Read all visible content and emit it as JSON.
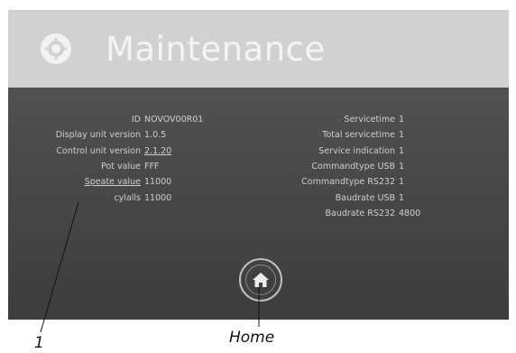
{
  "header": {
    "title": "Maintenance",
    "icon": "gear-icon",
    "background": "#d1d1d1",
    "title_color": "#f4f4f4"
  },
  "left_column": [
    {
      "label": "ID",
      "value": "NOVOV00R01"
    },
    {
      "label": "Display unit version",
      "value": "1.0.5"
    },
    {
      "label": "Control unit version",
      "value": "2.1.20"
    },
    {
      "label": "Pot value",
      "value": "FFF"
    },
    {
      "label": "Speate value",
      "value": "11000"
    },
    {
      "label": "cylalls",
      "value": "11000"
    }
  ],
  "right_column": [
    {
      "label": "Servicetime",
      "value": "1"
    },
    {
      "label": "Total servicetime",
      "value": "1"
    },
    {
      "label": "Service indication",
      "value": "1"
    },
    {
      "label": "Commandtype USB",
      "value": "1"
    },
    {
      "label": "Commandtype RS232",
      "value": "1"
    },
    {
      "label": "Baudrate USB",
      "value": "1"
    },
    {
      "label": "Baudrate RS232",
      "value": "4800"
    }
  ],
  "home_button": {
    "icon": "home-icon"
  },
  "callouts": {
    "marker_1": "1",
    "home": "Home"
  }
}
